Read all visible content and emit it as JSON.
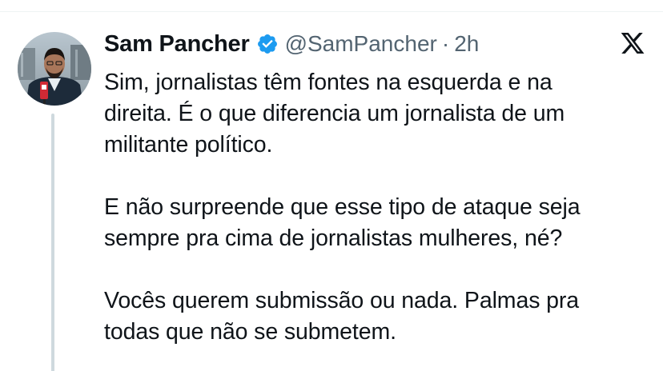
{
  "tweet": {
    "author": {
      "display_name": "Sam Pancher",
      "handle": "@SamPancher",
      "verified": true,
      "avatar_icon": "profile-photo"
    },
    "separator": "·",
    "time": "2h",
    "platform_icon": "x-logo-icon",
    "paragraphs": [
      {
        "lines": [
          "Sim, jornalistas têm fontes na esquerda e na",
          "direita. É o que diferencia um jornalista de um",
          "militante político."
        ]
      },
      {
        "lines": [
          "E não surpreende que esse tipo de ataque seja",
          "sempre pra cima de jornalistas mulheres, né?"
        ]
      },
      {
        "lines": [
          "Vocês querem submissão ou nada. Palmas pra",
          "todas que não se submetem."
        ]
      }
    ]
  },
  "colors": {
    "text_primary": "#0f1419",
    "text_secondary": "#536471",
    "verified_blue": "#1d9bf0",
    "thread_line": "#cfd9de"
  }
}
